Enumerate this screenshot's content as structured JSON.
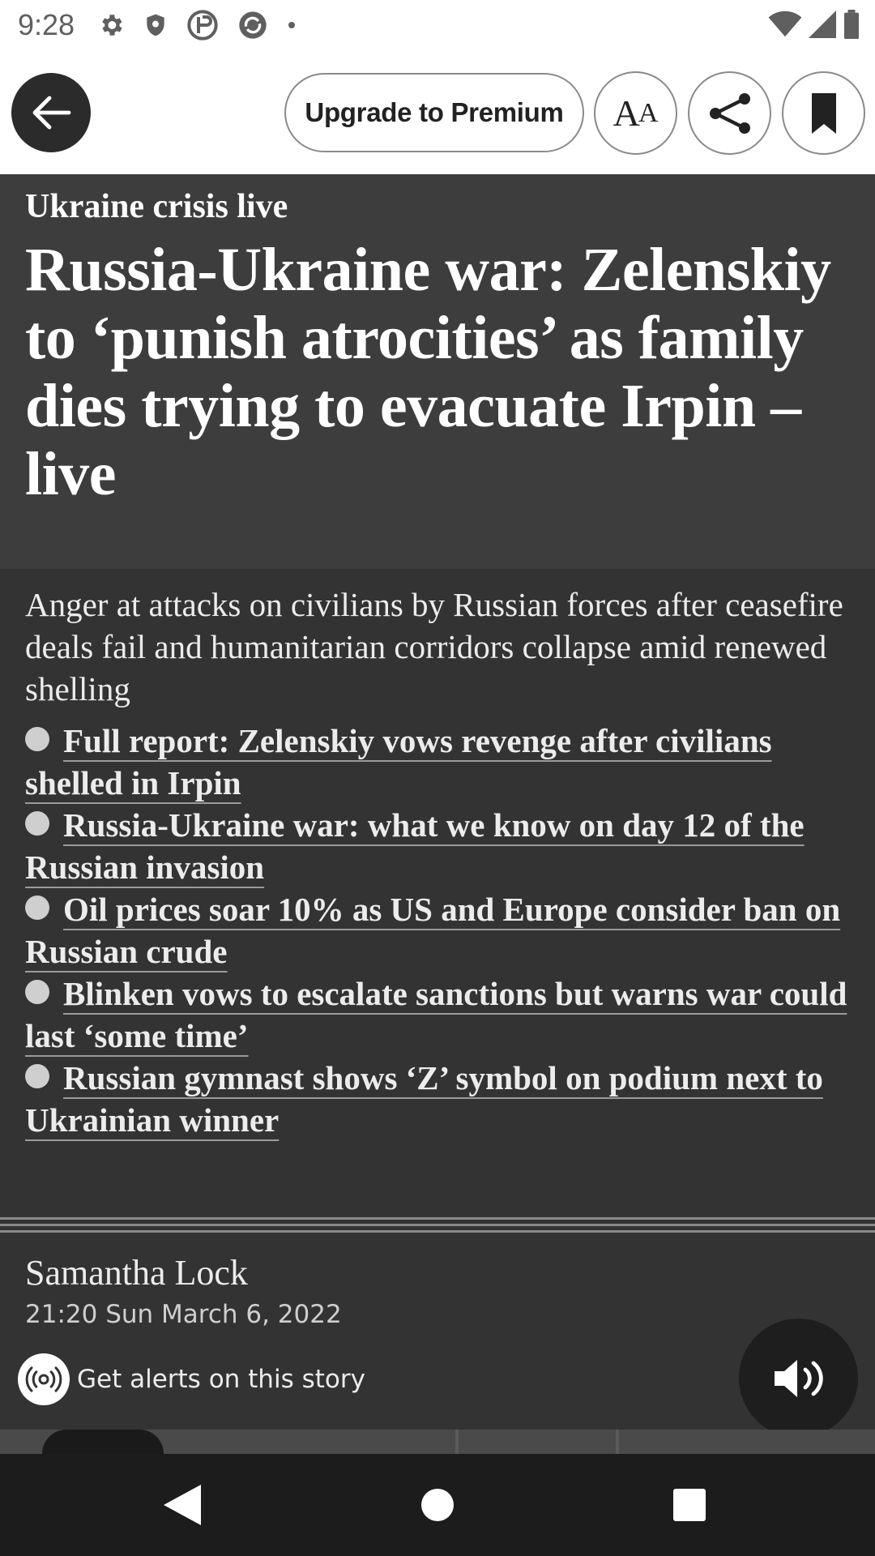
{
  "status_bar": {
    "time": "9:28",
    "left_icons": [
      "gear-icon",
      "shield-icon",
      "vpn-icon",
      "sync-icon",
      "dot-icon"
    ],
    "right_icons": [
      "wifi-icon",
      "signal-icon",
      "battery-icon"
    ]
  },
  "toolbar": {
    "back_icon": "arrow-left-icon",
    "premium_label": "Upgrade to Premium",
    "text_size_big": "A",
    "text_size_small": "A",
    "share_icon": "share-icon",
    "bookmark_icon": "bookmark-icon"
  },
  "article": {
    "kicker": "Ukraine crisis live",
    "headline": "Russia-Ukraine war: Zelenskiy to ‘punish atrocities’ as family dies trying to evacuate Irpin – live",
    "standfirst": "Anger at attacks on civilians by Russian forces after ceasefire deals fail and humanitarian corridors collapse amid renewed shelling",
    "related": [
      {
        "label": "Full report: Zelenskiy vows revenge after civilians shelled in Irpin"
      },
      {
        "label": "Russia-Ukraine war: what we know on day 12 of the Russian invasion"
      },
      {
        "label": "Oil prices soar 10% as US and Europe consider ban on Russian crude"
      },
      {
        "label": "Blinken vows to escalate sanctions but warns war could last ‘some time’"
      },
      {
        "label": "Russian gymnast shows ‘Z’ symbol on podium next to Ukrainian winner"
      }
    ],
    "byline": {
      "author": "Samantha Lock",
      "date": "21:20 Sun March 6, 2022"
    },
    "alerts_label": "Get alerts on this story",
    "alerts_icon": "broadcast-icon",
    "listen_icon": "speaker-icon"
  },
  "nav_bar": {
    "icons": [
      "nav-back-icon",
      "nav-home-icon",
      "nav-recents-icon"
    ]
  },
  "colors": {
    "headline_bg": "#3d3d3d",
    "body_bg": "#333333",
    "toolbar_bg": "#ffffff",
    "nav_bg": "#1c1c1c"
  }
}
